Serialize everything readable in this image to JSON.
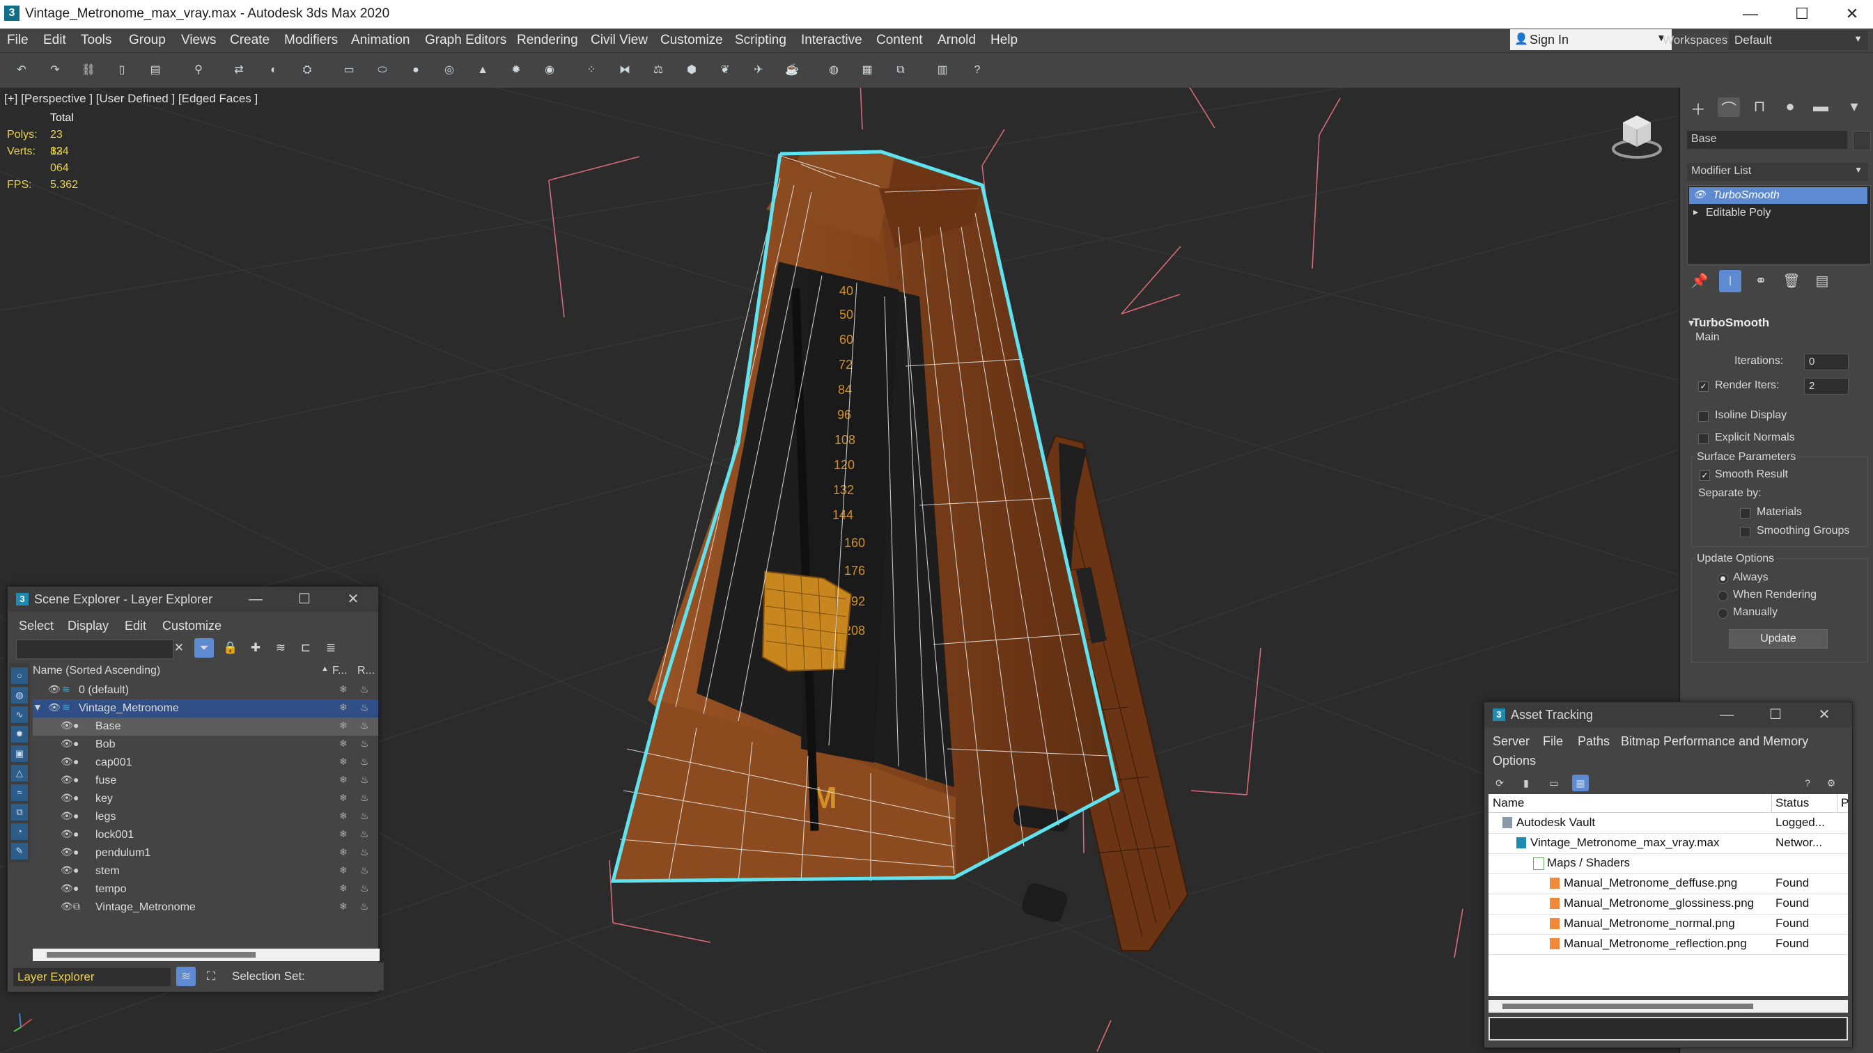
{
  "window": {
    "title": "Vintage_Metronome_max_vray.max - Autodesk 3ds Max 2020",
    "minimize": "—",
    "maximize": "☐",
    "close": "✕"
  },
  "menubar": [
    "File",
    "Edit",
    "Tools",
    "Group",
    "Views",
    "Create",
    "Modifiers",
    "Animation",
    "Graph Editors",
    "Rendering",
    "Civil View",
    "Customize",
    "Scripting",
    "Interactive",
    "Content",
    "Arnold",
    "Help"
  ],
  "account": {
    "sign_in": "Sign In",
    "workspaces_label": "Workspaces:",
    "workspace_value": "Default"
  },
  "viewport": {
    "label": "[+] [Perspective ] [User Defined ] [Edged Faces ]",
    "stats": {
      "total_label": "Total",
      "polys_label": "Polys:",
      "polys_value": "23 834",
      "verts_label": "Verts:",
      "verts_value": "12 064",
      "fps_label": "FPS:",
      "fps_value": "5.362"
    },
    "scale_marks": [
      "40",
      "50",
      "60",
      "72",
      "84",
      "96",
      "108",
      "120",
      "132",
      "144",
      "160",
      "176",
      "192",
      "208"
    ],
    "logo_letter": "M"
  },
  "command_panel": {
    "object_name": "Base",
    "modifier_list": "Modifier List",
    "stack": [
      {
        "label": "TurboSmooth",
        "selected": true
      },
      {
        "label": "Editable Poly",
        "selected": false
      }
    ],
    "rollout": {
      "title": "TurboSmooth",
      "main_label": "Main",
      "iterations_label": "Iterations:",
      "iterations_value": "0",
      "render_iters_label": "Render Iters:",
      "render_iters_value": "2",
      "isoline_label": "Isoline Display",
      "explicit_normals_label": "Explicit Normals",
      "surface_params_label": "Surface Parameters",
      "smooth_result_label": "Smooth Result",
      "separate_by_label": "Separate by:",
      "materials_label": "Materials",
      "smoothing_groups_label": "Smoothing Groups",
      "update_options_label": "Update Options",
      "always_label": "Always",
      "when_rendering_label": "When Rendering",
      "manually_label": "Manually",
      "update_button": "Update"
    }
  },
  "scene_explorer": {
    "title": "Scene Explorer - Layer Explorer",
    "menu": [
      "Select",
      "Display",
      "Edit",
      "Customize"
    ],
    "column_name": "Name (Sorted Ascending)",
    "column_sort_arrow": "▲",
    "column_f": "F...",
    "column_r": "R...",
    "rows": [
      {
        "name": "0 (default)",
        "level": 0,
        "selected": false
      },
      {
        "name": "Vintage_Metronome",
        "level": 0,
        "selected": false,
        "highlight": true
      },
      {
        "name": "Base",
        "level": 1,
        "selected": true
      },
      {
        "name": "Bob",
        "level": 1,
        "selected": false
      },
      {
        "name": "cap001",
        "level": 1,
        "selected": false
      },
      {
        "name": "fuse",
        "level": 1,
        "selected": false
      },
      {
        "name": "key",
        "level": 1,
        "selected": false
      },
      {
        "name": "legs",
        "level": 1,
        "selected": false
      },
      {
        "name": "lock001",
        "level": 1,
        "selected": false
      },
      {
        "name": "pendulum1",
        "level": 1,
        "selected": false
      },
      {
        "name": "stem",
        "level": 1,
        "selected": false
      },
      {
        "name": "tempo",
        "level": 1,
        "selected": false
      },
      {
        "name": "Vintage_Metronome",
        "level": 1,
        "selected": false
      }
    ],
    "layer_explorer": "Layer Explorer",
    "selection_set_label": "Selection Set:"
  },
  "asset_tracking": {
    "title": "Asset Tracking",
    "menu": [
      "Server",
      "File",
      "Paths",
      "Bitmap Performance and Memory",
      "Options"
    ],
    "col_name": "Name",
    "col_status": "Status",
    "col_extra": "P",
    "rows": [
      {
        "name": "Autodesk Vault",
        "status": "Logged...",
        "level": 0
      },
      {
        "name": "Vintage_Metronome_max_vray.max",
        "status": "Networ...",
        "level": 1
      },
      {
        "name": "Maps / Shaders",
        "status": "",
        "level": 2
      },
      {
        "name": "Manual_Metronome_deffuse.png",
        "status": "Found",
        "level": 3
      },
      {
        "name": "Manual_Metronome_glossiness.png",
        "status": "Found",
        "level": 3
      },
      {
        "name": "Manual_Metronome_normal.png",
        "status": "Found",
        "level": 3
      },
      {
        "name": "Manual_Metronome_reflection.png",
        "status": "Found",
        "level": 3
      }
    ]
  },
  "colors": {
    "accent": "#5e8ad1",
    "selection_outline": "#5fe3f0",
    "wood": "#8a4a1f",
    "stats": "#e8d24a"
  }
}
